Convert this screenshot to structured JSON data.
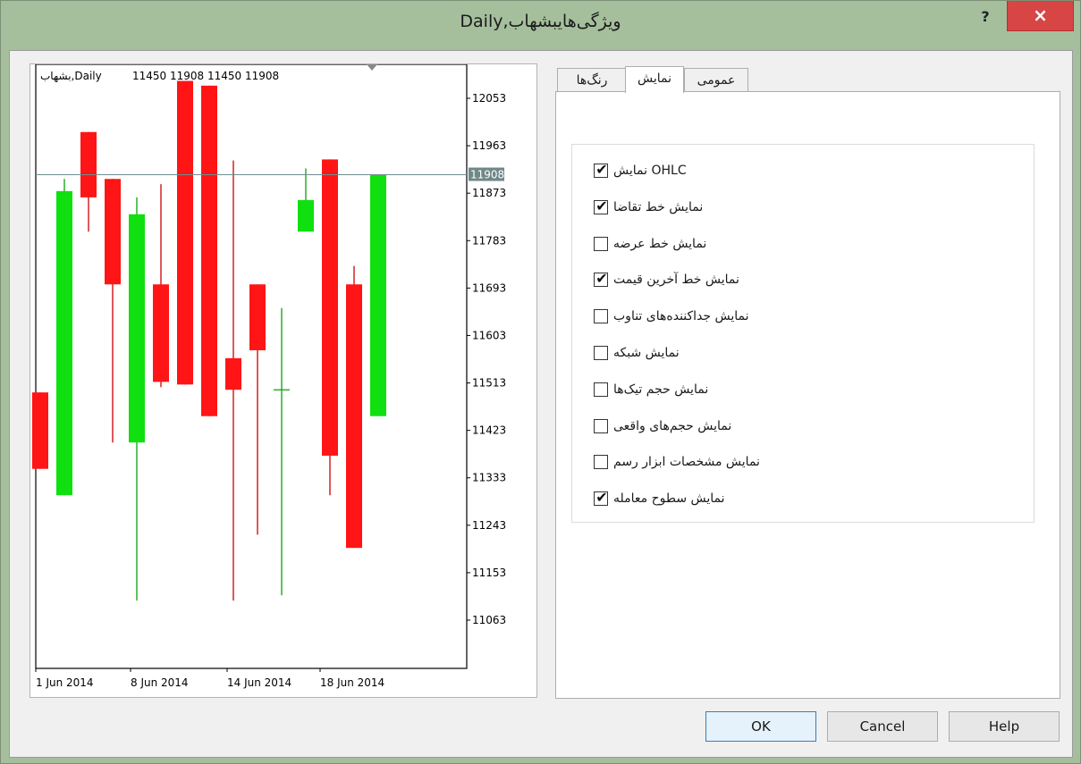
{
  "window": {
    "title": "Daily,ویژگی‌هایبشهاب",
    "help_glyph": "?",
    "close_glyph": "×"
  },
  "chart": {
    "header_symbol": "بشهاب,Daily",
    "header_values": "11450 11908 11450 11908",
    "last_price_label": "11908",
    "y_ticks": [
      "12053",
      "11963",
      "11873",
      "11783",
      "11693",
      "11603",
      "11513",
      "11423",
      "11333",
      "11243",
      "11153",
      "11063"
    ],
    "x_ticks": [
      "1 Jun 2014",
      "8 Jun 2014",
      "14 Jun 2014",
      "18 Jun 2014"
    ],
    "colors": {
      "bull": "#10e010",
      "bear": "#ff1515",
      "bull_wick": "#0aa00a",
      "bear_wick": "#cc0000",
      "grid_line": "#6f8f8f"
    }
  },
  "chart_data": {
    "type": "candlestick",
    "title": "",
    "symbol": "بشهاب",
    "timeframe": "Daily",
    "ylim": [
      11000,
      12100
    ],
    "last_price": 11908,
    "x_ticks": [
      "1 Jun 2014",
      "8 Jun 2014",
      "14 Jun 2014",
      "18 Jun 2014"
    ],
    "candles": [
      {
        "open": 11495,
        "high": 11495,
        "low": 11350,
        "close": 11350
      },
      {
        "open": 11300,
        "high": 11900,
        "low": 11300,
        "close": 11877
      },
      {
        "open": 11989,
        "high": 11989,
        "low": 11800,
        "close": 11865
      },
      {
        "open": 11900,
        "high": 11900,
        "low": 11400,
        "close": 11700
      },
      {
        "open": 11400,
        "high": 11865,
        "low": 11100,
        "close": 11833
      },
      {
        "open": 11700,
        "high": 11890,
        "low": 11505,
        "close": 11515
      },
      {
        "open": 12086,
        "high": 12086,
        "low": 11510,
        "close": 11510
      },
      {
        "open": 12077,
        "high": 12077,
        "low": 11450,
        "close": 11450
      },
      {
        "open": 11560,
        "high": 11935,
        "low": 11100,
        "close": 11500
      },
      {
        "open": 11700,
        "high": 11700,
        "low": 11225,
        "close": 11575
      },
      {
        "open": 11500,
        "high": 11655,
        "low": 11110,
        "close": 11500
      },
      {
        "open": 11800,
        "high": 11920,
        "low": 11800,
        "close": 11860
      },
      {
        "open": 11937,
        "high": 11937,
        "low": 11300,
        "close": 11375
      },
      {
        "open": 11700,
        "high": 11735,
        "low": 11200,
        "close": 11200
      },
      {
        "open": 11450,
        "high": 11908,
        "low": 11450,
        "close": 11908
      }
    ]
  },
  "tabs": [
    {
      "label": "رنگ‌ها",
      "active": false
    },
    {
      "label": "نمایش",
      "active": true
    },
    {
      "label": "عمومی",
      "active": false
    }
  ],
  "options": [
    {
      "label": "نمایش OHLC",
      "checked": true
    },
    {
      "label": "نمایش خط تقاضا",
      "checked": true
    },
    {
      "label": "نمایش خط عرضه",
      "checked": false
    },
    {
      "label": "نمایش خط آخرین قیمت",
      "checked": true
    },
    {
      "label": "نمایش جداکننده‌های تناوب",
      "checked": false
    },
    {
      "label": "نمایش شبکه",
      "checked": false
    },
    {
      "label": "نمایش حجم تیک‌ها",
      "checked": false
    },
    {
      "label": "نمایش حجم‌های واقعی",
      "checked": false
    },
    {
      "label": "نمایش مشخصات ابزار رسم",
      "checked": false
    },
    {
      "label": "نمایش سطوح معامله",
      "checked": true
    }
  ],
  "check_glyph": "✔",
  "buttons": {
    "ok": "OK",
    "cancel": "Cancel",
    "help": "Help"
  }
}
